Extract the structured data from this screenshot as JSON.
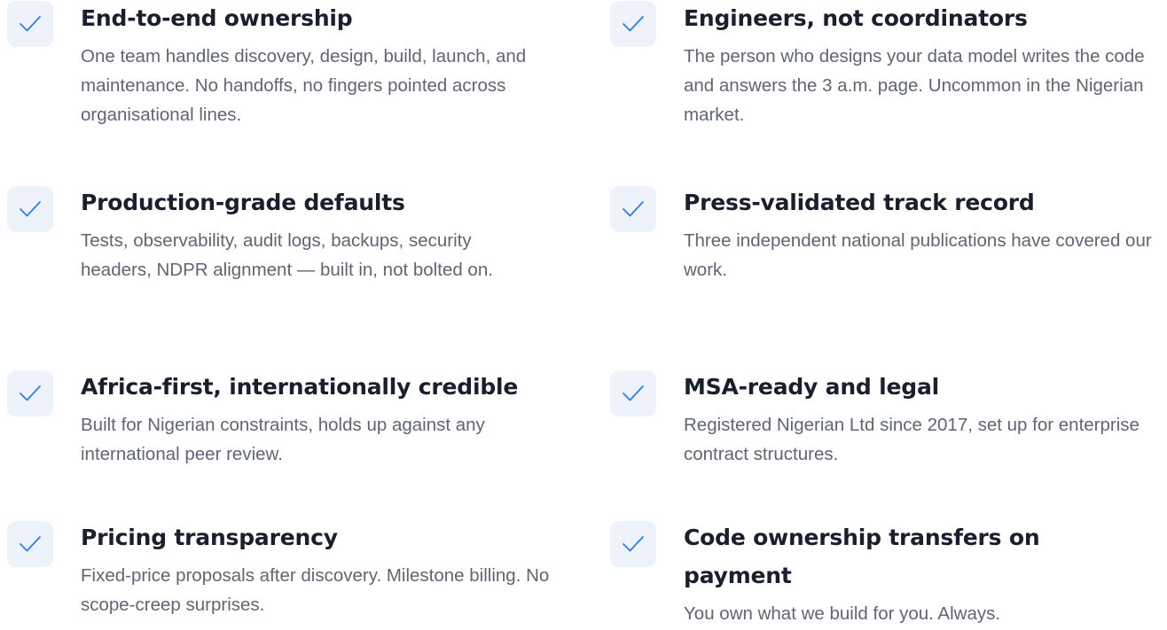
{
  "check_icon_color": "#2f7de0",
  "features": [
    {
      "title": "End-to-end ownership",
      "description": "One team handles discovery, design, build, launch, and maintenance. No handoffs, no fingers pointed across organisational lines."
    },
    {
      "title": "Engineers, not coordinators",
      "description": "The person who designs your data model writes the code and answers the 3 a.m. page. Uncommon in the Nigerian market."
    },
    {
      "title": "Production-grade defaults",
      "description": "Tests, observability, audit logs, backups, security headers, NDPR alignment — built in, not bolted on."
    },
    {
      "title": "Press-validated track record",
      "description": "Three independent national publications have covered our work."
    },
    {
      "title": "Africa-first, internationally credible",
      "description": "Built for Nigerian constraints, holds up against any international peer review."
    },
    {
      "title": "MSA-ready and legal",
      "description": "Registered Nigerian Ltd since 2017, set up for enterprise contract structures."
    },
    {
      "title": "Pricing transparency",
      "description": "Fixed-price proposals after discovery. Milestone billing. No scope-creep surprises."
    },
    {
      "title": "Code ownership transfers on payment",
      "description": "You own what we build for you. Always."
    }
  ]
}
